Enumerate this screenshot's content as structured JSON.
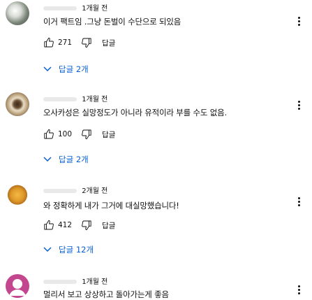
{
  "comments": [
    {
      "time": "1개월 전",
      "text": "이거 팩트임 .그냥 돈벌이 수단으로 되있음",
      "likes": "271",
      "reply_label": "답글",
      "replies_label": "답글 2개"
    },
    {
      "time": "1개월 전",
      "text": "오사카성은 실망정도가 아니라 유적이라 부를 수도 없음.",
      "likes": "100",
      "reply_label": "답글",
      "replies_label": "답글 2개"
    },
    {
      "time": "2개월 전",
      "text": "와 정확하게 내가 그거에 대실망했습니다!",
      "likes": "412",
      "reply_label": "답글",
      "replies_label": "답글 12개"
    },
    {
      "time": "1개월 전",
      "text": "멀리서 보고 상상하고 돌아가는게 좋음"
    }
  ],
  "colors": {
    "link_blue": "#065fd4",
    "text": "#0f0f0f",
    "avatar4": "#c2478e"
  },
  "icons": [
    "like-icon",
    "dislike-icon",
    "chevron-down-icon",
    "more-vert-icon",
    "default-avatar-icon"
  ]
}
